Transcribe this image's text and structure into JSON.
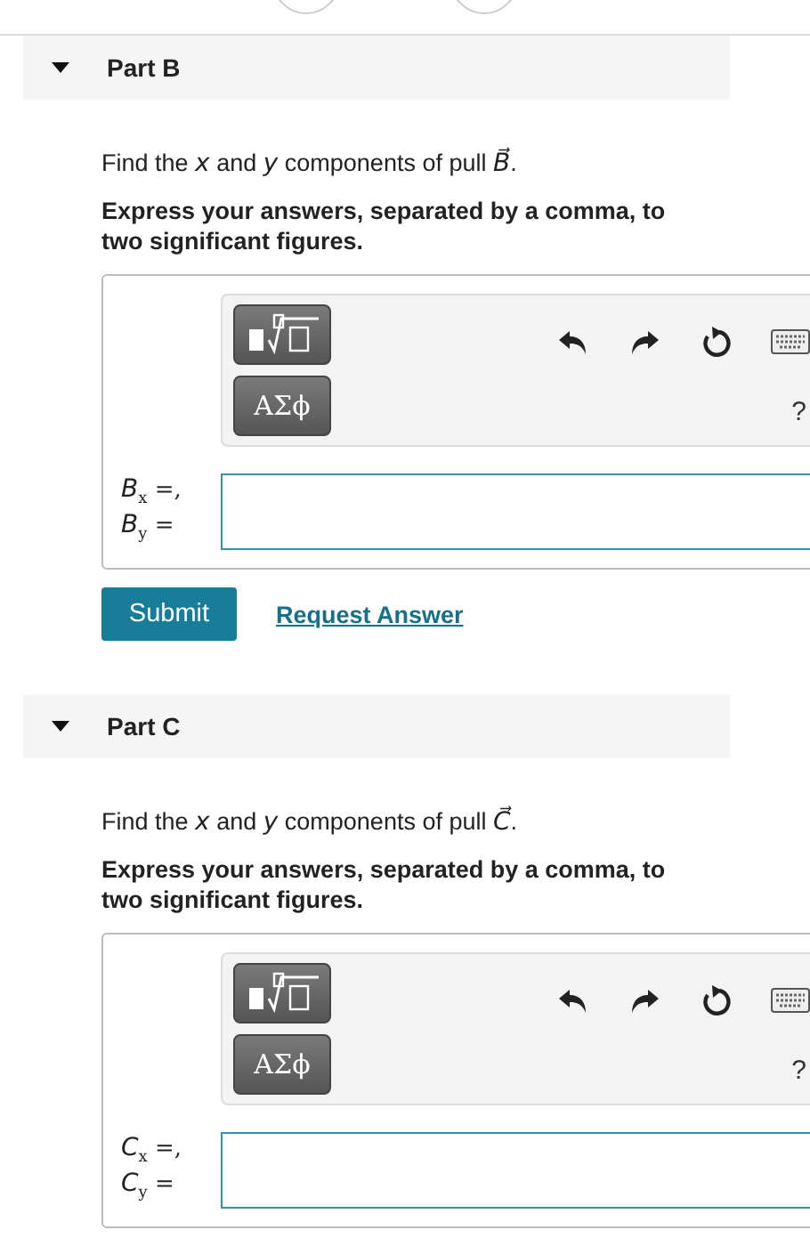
{
  "parts": [
    {
      "title": "Part B",
      "expanded": true,
      "prompt": "Find the *x* and *y* components of pull *B⃗*.",
      "instruction": "Express your answers, separated by a comma, to two significant figures.",
      "template_buttons": [
        "ΑΣϕ"
      ],
      "help": "?",
      "labels": [
        "*B*$_{x}$ =,",
        "*B*$_{y}$ ="
      ],
      "actions": {
        "submit": "Submit",
        "request": "Request Answer"
      }
    },
    {
      "title": "Part C",
      "expanded": true,
      "prompt": "Find the *x* and *y* components of pull *C⃗*.",
      "instruction": "Express your answers, separated by a comma, to two significant figures.",
      "template_buttons": [
        "ΑΣϕ"
      ],
      "help": "?",
      "labels": [
        "*C*$_{x}$ =,",
        "*C*$_{y}$ ="
      ]
    }
  ]
}
